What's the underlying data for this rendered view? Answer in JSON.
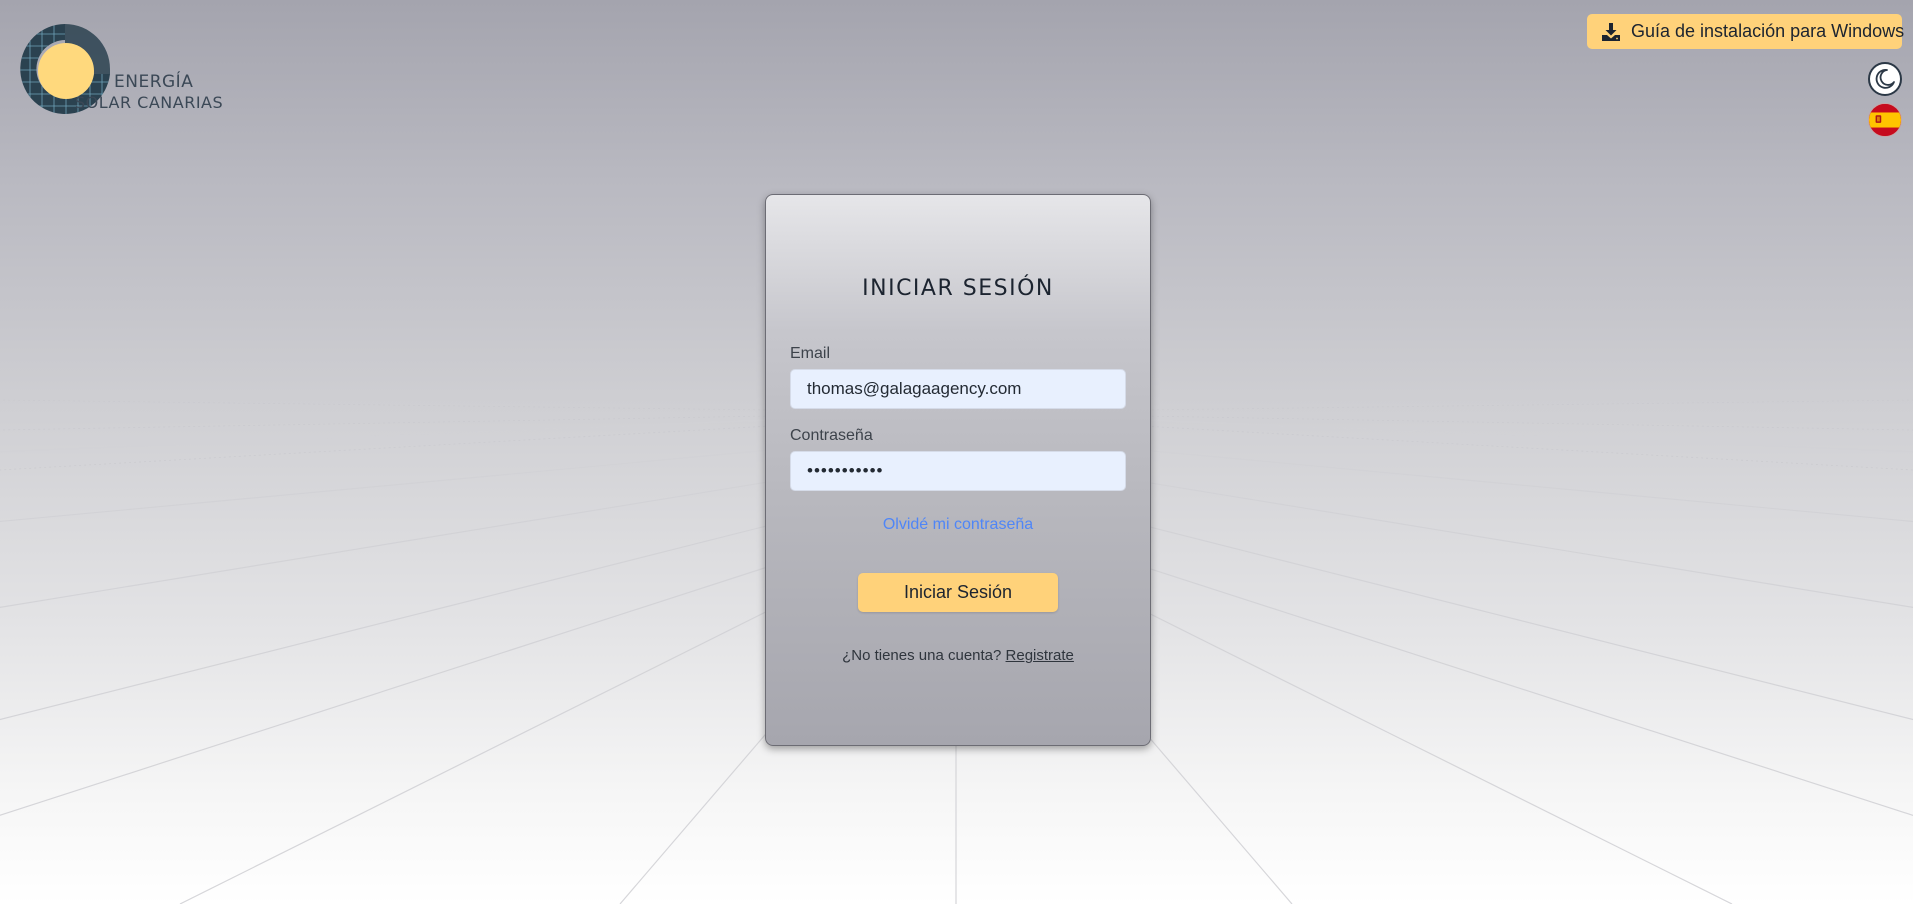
{
  "logo": {
    "line1": "ENERGÍA",
    "line2": "SOLAR CANARIAS",
    "icon": "sun-grid-logo"
  },
  "header": {
    "install_label": "Guía de instalación para Windows",
    "install_icon": "download-icon",
    "theme_icon": "moon-icon",
    "language_icon": "spain-flag-icon"
  },
  "login": {
    "title": "INICIAR SESIÓN",
    "email_label": "Email",
    "email_value": "thomas@galagaagency.com",
    "password_label": "Contraseña",
    "password_value": "•••••••••••",
    "forgot_label": "Olvidé mi contraseña",
    "submit_label": "Iniciar Sesión",
    "no_account_text": "¿No tienes una cuenta?",
    "register_label": "Registrate"
  },
  "colors": {
    "accent": "#ffd27a",
    "link": "#4f86f7",
    "input_bg": "#e8f0fe",
    "dark": "#1c2430"
  }
}
